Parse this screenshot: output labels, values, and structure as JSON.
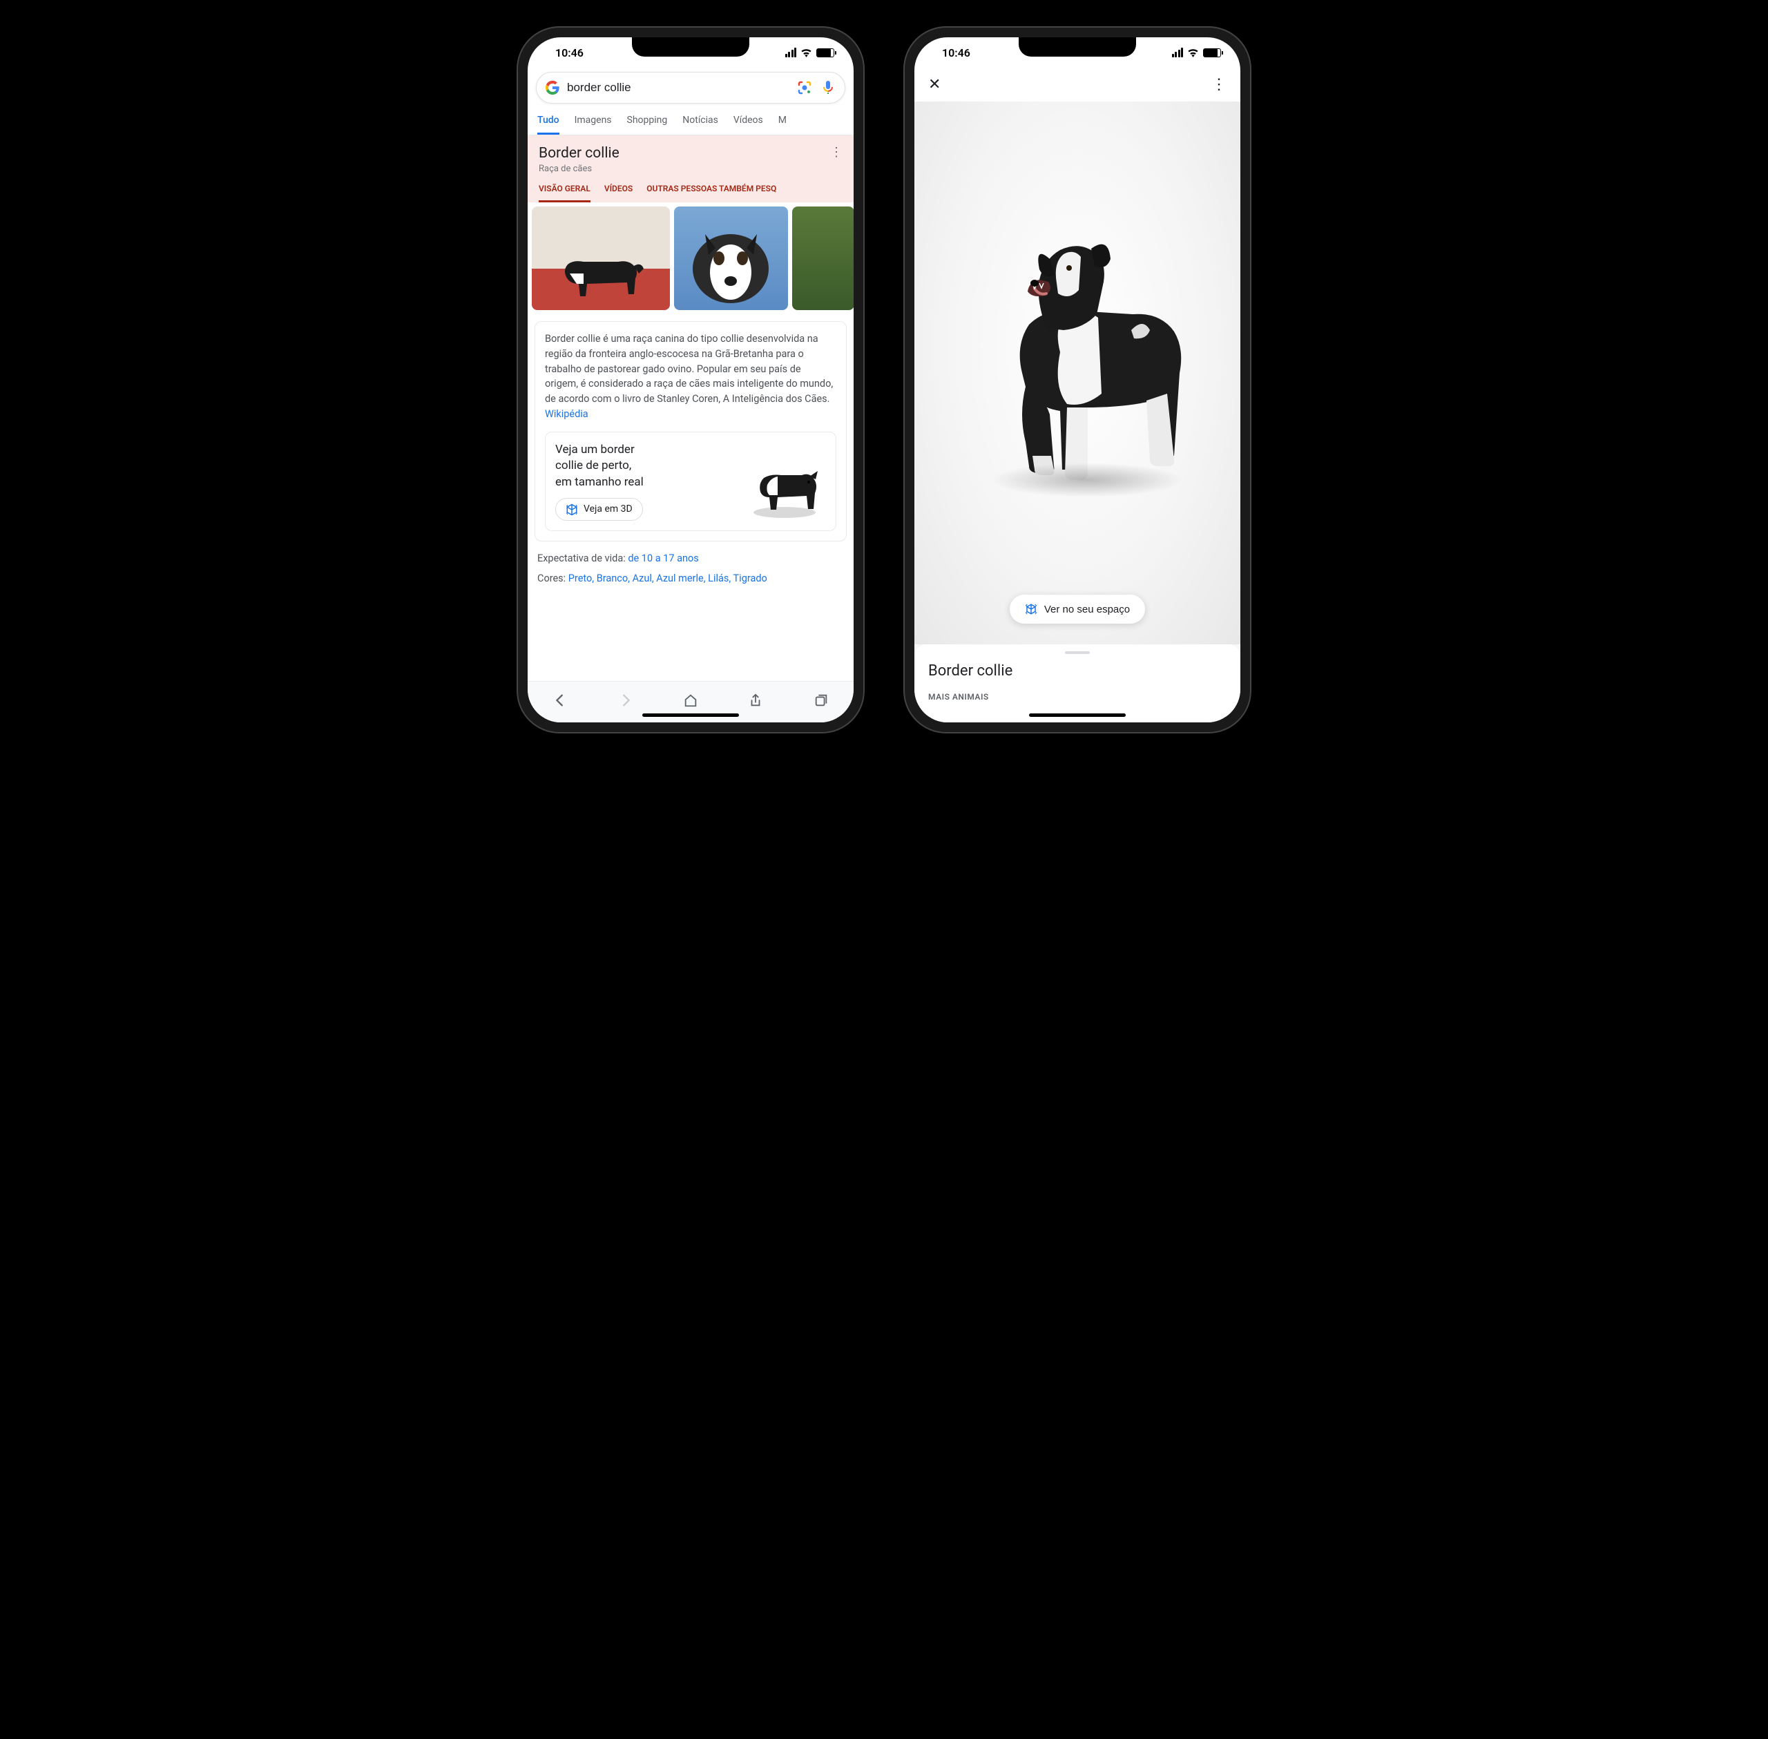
{
  "status": {
    "time": "10:46"
  },
  "phone1": {
    "search": {
      "query": "border collie"
    },
    "tabs": [
      "Tudo",
      "Imagens",
      "Shopping",
      "Notícias",
      "Vídeos",
      "M"
    ],
    "kp": {
      "title": "Border collie",
      "subtitle": "Raça de cães",
      "tabs": [
        "VISÃO GERAL",
        "VÍDEOS",
        "OUTRAS PESSOAS TAMBÉM PESQ"
      ]
    },
    "description": "Border collie é uma raça canina do tipo collie desenvolvida na região da fronteira anglo-escocesa na Grã-Bretanha para o trabalho de pastorear gado ovino. Popular em seu país de origem, é considerado a raça de cães mais inteligente do mundo, de acordo com o livro de Stanley Coren, A Inteligência dos Cães. ",
    "wiki_label": "Wikipédia",
    "ar_card": {
      "line1": "Veja um border",
      "line2": "collie de perto,",
      "line3": "em tamanho real",
      "button": "Veja em 3D"
    },
    "facts": {
      "life_label": "Expectativa de vida: ",
      "life_value": "de 10 a 17 anos",
      "colors_label": "Cores: ",
      "colors_value": "Preto, Branco, Azul, Azul merle, Lilás, Tigrado"
    }
  },
  "phone2": {
    "ar_button": "Ver no seu espaço",
    "sheet_title": "Border collie",
    "section_label": "MAIS ANIMAIS"
  },
  "icons": {
    "google_g": "G",
    "lens": "lens-icon",
    "mic": "mic-icon",
    "cube": "cube-3d-icon",
    "close": "✕",
    "more": "⋮",
    "back": "‹",
    "forward": "›"
  }
}
